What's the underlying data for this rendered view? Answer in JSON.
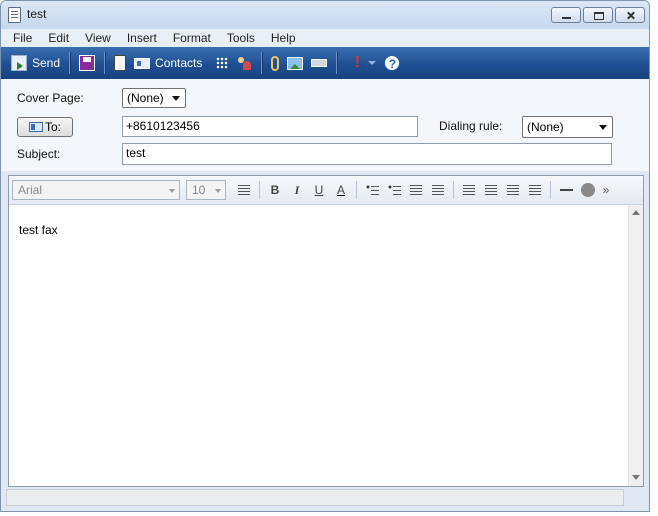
{
  "window": {
    "title": "test"
  },
  "menu": [
    "File",
    "Edit",
    "View",
    "Insert",
    "Format",
    "Tools",
    "Help"
  ],
  "toolbar": {
    "send_label": "Send",
    "contacts_label": "Contacts"
  },
  "fields": {
    "cover_page_label": "Cover Page:",
    "cover_page_value": "(None)",
    "to_button_label": "To:",
    "to_value": "+8610123456",
    "dialing_rule_label": "Dialing rule:",
    "dialing_rule_value": "(None)",
    "subject_label": "Subject:",
    "subject_value": "test"
  },
  "format": {
    "font_value": "Arial",
    "size_value": "10",
    "bold": "B",
    "italic": "I",
    "underline": "U",
    "fontcolor": "A",
    "more": "»"
  },
  "body_text": "test fax",
  "icons": [
    "send-icon",
    "save-icon",
    "page-icon",
    "contacts-icon",
    "grid-icon",
    "people-icon",
    "attach-icon",
    "picture-icon",
    "line-icon",
    "priority-icon",
    "help-icon"
  ]
}
